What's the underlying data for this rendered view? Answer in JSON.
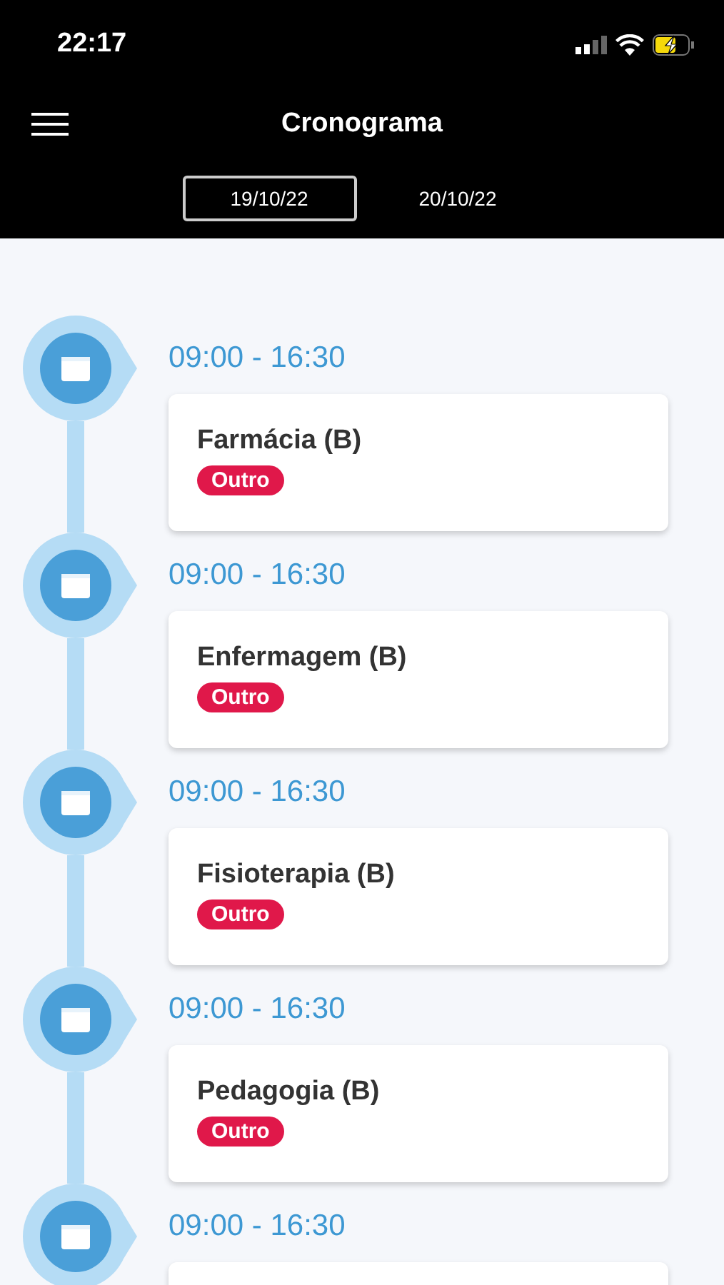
{
  "status_bar": {
    "time": "22:17"
  },
  "header": {
    "title": "Cronograma"
  },
  "date_tabs": [
    {
      "label": "19/10/22",
      "selected": true
    },
    {
      "label": "20/10/22",
      "selected": false
    }
  ],
  "events": [
    {
      "time": "09:00 - 16:30",
      "title": "Farmácia (B)",
      "tag": "Outro"
    },
    {
      "time": "09:00 - 16:30",
      "title": "Enfermagem (B)",
      "tag": "Outro"
    },
    {
      "time": "09:00 - 16:30",
      "title": "Fisioterapia (B)",
      "tag": "Outro"
    },
    {
      "time": "09:00 - 16:30",
      "title": "Pedagogia (B)",
      "tag": "Outro"
    },
    {
      "time": "09:00 - 16:30"
    }
  ]
}
